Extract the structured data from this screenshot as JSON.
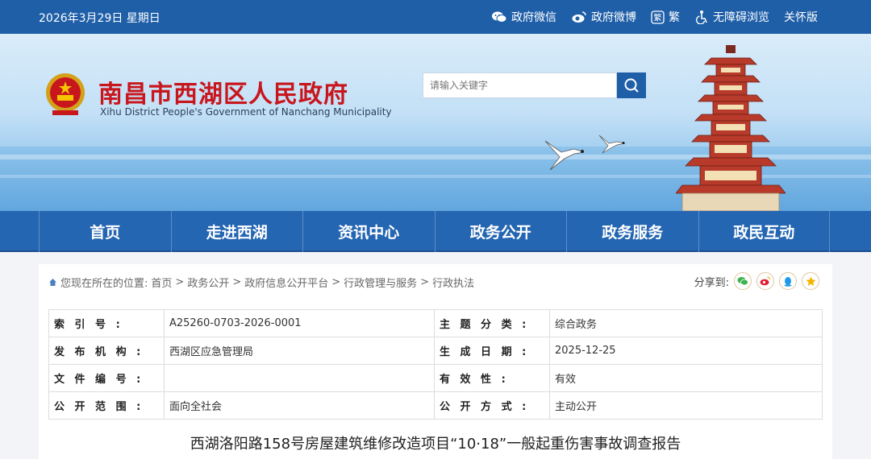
{
  "topbar": {
    "date": "2026年3月29日 星期日",
    "links": [
      {
        "label": "政府微信",
        "icon": "wechat-icon"
      },
      {
        "label": "政府微博",
        "icon": "weibo-icon"
      },
      {
        "label": "繁",
        "icon": "traditional-chinese-icon"
      },
      {
        "label": "无障碍浏览",
        "icon": "accessibility-icon"
      },
      {
        "label": "关怀版",
        "icon": ""
      }
    ]
  },
  "header": {
    "title": "南昌市西湖区人民政府",
    "subtitle": "Xihu District People's Government of Nanchang Municipality",
    "search_placeholder": "请输入关键字"
  },
  "nav": {
    "items": [
      "首页",
      "走进西湖",
      "资讯中心",
      "政务公开",
      "政务服务",
      "政民互动"
    ]
  },
  "breadcrumb": {
    "prefix": "您现在所在的位置:",
    "items": [
      "首页",
      "政务公开",
      "政府信息公开平台",
      "行政管理与服务",
      "行政执法"
    ]
  },
  "share": {
    "label": "分享到:"
  },
  "meta": {
    "index_no_label": "索 引 号 :",
    "index_no": "A25260-0703-2026-0001",
    "subject_label": "主 题 分 类 :",
    "subject": "综合政务",
    "publisher_label": "发 布 机 构 :",
    "publisher": "西湖区应急管理局",
    "date_label": "生 成 日 期 :",
    "date": "2025-12-25",
    "doc_no_label": "文 件 编 号 :",
    "doc_no": "",
    "validity_label": "有 效 性 :",
    "validity": "有效",
    "scope_label": "公 开 范 围 :",
    "scope": "面向全社会",
    "method_label": "公 开 方 式 :",
    "method": "主动公开"
  },
  "document": {
    "title": "西湖洛阳路158号房屋建筑维修改造项目“10·18”一般起重伤害事故调查报告"
  },
  "colors": {
    "brand_blue": "#1f5fa8",
    "nav_blue": "#2466b2",
    "title_red": "#c8161d"
  }
}
